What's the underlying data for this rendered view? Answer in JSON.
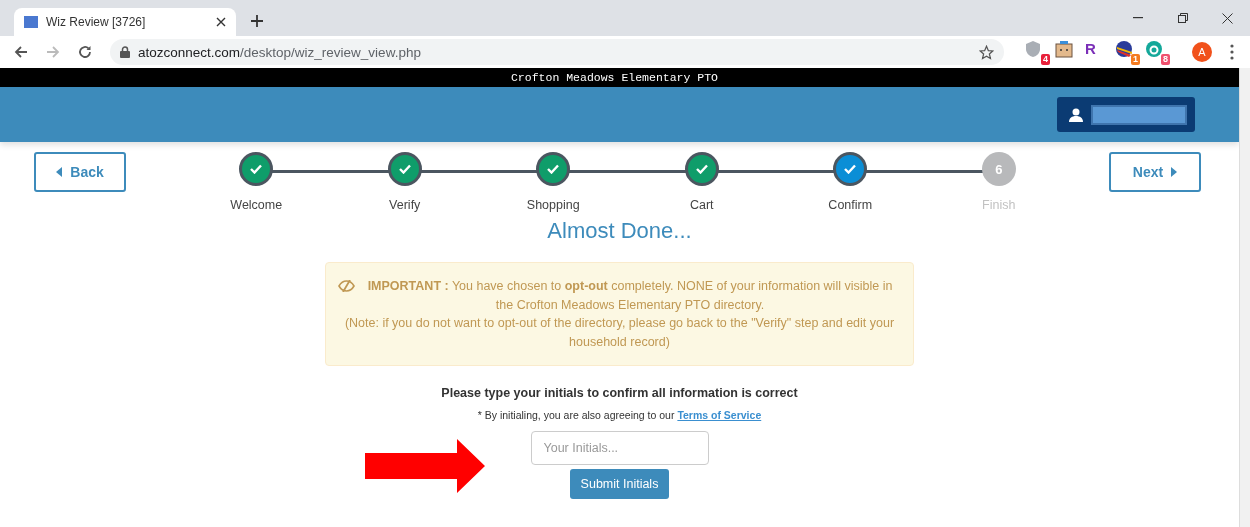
{
  "browser": {
    "tab_title": "Wiz Review [3726]",
    "url_host": "atozconnect.com",
    "url_path": "/desktop/wiz_review_view.php",
    "extensions": [
      {
        "kind": "shield",
        "badge": "4",
        "color": "#e8203a"
      },
      {
        "kind": "box"
      },
      {
        "kind": "letter",
        "label": "R"
      },
      {
        "kind": "ball",
        "badge": "1",
        "color": "#f47b20"
      },
      {
        "kind": "round",
        "badge": "8",
        "color": "#f0506e"
      }
    ],
    "profile": "A"
  },
  "org_bar": {
    "title": "Crofton Meadows Elementary PTO"
  },
  "wizard": {
    "back": "Back",
    "next": "Next",
    "steps": [
      {
        "label": "Welcome",
        "completed": true,
        "selected": false
      },
      {
        "label": "Verify",
        "completed": true,
        "selected": false
      },
      {
        "label": "Shopping",
        "completed": true,
        "selected": false
      },
      {
        "label": "Cart",
        "completed": true,
        "selected": false
      },
      {
        "label": "Confirm",
        "completed": true,
        "selected": true
      },
      {
        "label": "Finish",
        "completed": false,
        "selected": false,
        "number": "6"
      }
    ]
  },
  "heading": "Almost Done...",
  "notice": {
    "text": "**IMPORTANT :** You have chosen to **opt-out** completely. NONE of your information will visible in the Crofton Meadows Elementary PTO directory.",
    "note": "(Note: if you do not want to opt-out of the directory, please go back to the \"Verify\" step and edit your household record)"
  },
  "confirm": {
    "prompt": "Please type your initials to confirm all information is correct",
    "agreement": "* By initialing, you are also agreeing to our",
    "link": "Terms of Service",
    "placeholder": "Your Initials...",
    "submit": "Submit Initials"
  }
}
